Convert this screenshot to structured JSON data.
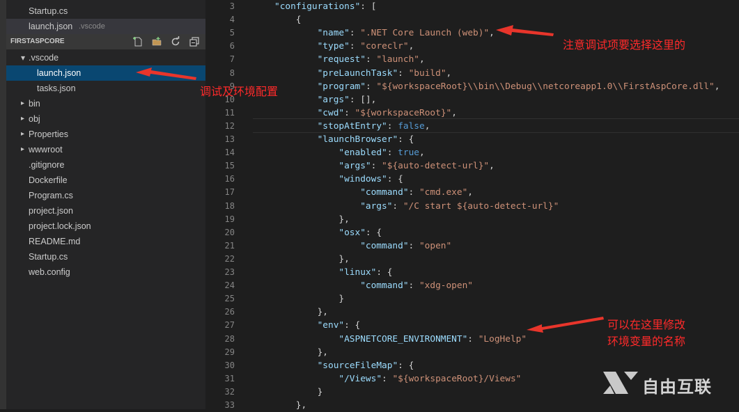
{
  "explorer": {
    "open_editors": [
      {
        "label": "Startup.cs",
        "suffix": ""
      },
      {
        "label": "launch.json",
        "suffix": ".vscode"
      }
    ],
    "section_title": "FIRSTASPCORE",
    "tree": [
      {
        "label": ".vscode",
        "level": 1,
        "chevron": "down"
      },
      {
        "label": "launch.json",
        "level": 2,
        "chevron": "",
        "selected": true
      },
      {
        "label": "tasks.json",
        "level": 2,
        "chevron": ""
      },
      {
        "label": "bin",
        "level": 1,
        "chevron": "right"
      },
      {
        "label": "obj",
        "level": 1,
        "chevron": "right"
      },
      {
        "label": "Properties",
        "level": 1,
        "chevron": "right"
      },
      {
        "label": "wwwroot",
        "level": 1,
        "chevron": "right"
      },
      {
        "label": ".gitignore",
        "level": 1,
        "chevron": ""
      },
      {
        "label": "Dockerfile",
        "level": 1,
        "chevron": ""
      },
      {
        "label": "Program.cs",
        "level": 1,
        "chevron": ""
      },
      {
        "label": "project.json",
        "level": 1,
        "chevron": ""
      },
      {
        "label": "project.lock.json",
        "level": 1,
        "chevron": ""
      },
      {
        "label": "README.md",
        "level": 1,
        "chevron": ""
      },
      {
        "label": "Startup.cs",
        "level": 1,
        "chevron": ""
      },
      {
        "label": "web.config",
        "level": 1,
        "chevron": ""
      }
    ]
  },
  "editor": {
    "current_line": 12,
    "lines": [
      {
        "n": "3",
        "indent": 0,
        "parts": [
          [
            "k",
            "\"configurations\""
          ],
          [
            "p",
            ": ["
          ]
        ]
      },
      {
        "n": "4",
        "indent": 1,
        "parts": [
          [
            "p",
            "{"
          ]
        ]
      },
      {
        "n": "5",
        "indent": 2,
        "parts": [
          [
            "k",
            "\"name\""
          ],
          [
            "p",
            ": "
          ],
          [
            "s",
            "\".NET Core Launch (web)\""
          ],
          [
            "p",
            ","
          ]
        ]
      },
      {
        "n": "6",
        "indent": 2,
        "parts": [
          [
            "k",
            "\"type\""
          ],
          [
            "p",
            ": "
          ],
          [
            "s",
            "\"coreclr\""
          ],
          [
            "p",
            ","
          ]
        ]
      },
      {
        "n": "7",
        "indent": 2,
        "parts": [
          [
            "k",
            "\"request\""
          ],
          [
            "p",
            ": "
          ],
          [
            "s",
            "\"launch\""
          ],
          [
            "p",
            ","
          ]
        ]
      },
      {
        "n": "8",
        "indent": 2,
        "parts": [
          [
            "k",
            "\"preLaunchTask\""
          ],
          [
            "p",
            ": "
          ],
          [
            "s",
            "\"build\""
          ],
          [
            "p",
            ","
          ]
        ]
      },
      {
        "n": "9",
        "indent": 2,
        "parts": [
          [
            "k",
            "\"program\""
          ],
          [
            "p",
            ": "
          ],
          [
            "s",
            "\"${workspaceRoot}\\\\bin\\\\Debug\\\\netcoreapp1.0\\\\FirstAspCore.dll\""
          ],
          [
            "p",
            ","
          ]
        ]
      },
      {
        "n": "10",
        "indent": 2,
        "parts": [
          [
            "k",
            "\"args\""
          ],
          [
            "p",
            ": [],"
          ]
        ]
      },
      {
        "n": "11",
        "indent": 2,
        "parts": [
          [
            "k",
            "\"cwd\""
          ],
          [
            "p",
            ": "
          ],
          [
            "s",
            "\"${workspaceRoot}\""
          ],
          [
            "p",
            ","
          ]
        ]
      },
      {
        "n": "12",
        "indent": 2,
        "parts": [
          [
            "k",
            "\"stopAtEntry\""
          ],
          [
            "p",
            ": "
          ],
          [
            "b",
            "false"
          ],
          [
            "p",
            ","
          ]
        ]
      },
      {
        "n": "13",
        "indent": 2,
        "parts": [
          [
            "k",
            "\"launchBrowser\""
          ],
          [
            "p",
            ": {"
          ]
        ]
      },
      {
        "n": "14",
        "indent": 3,
        "parts": [
          [
            "k",
            "\"enabled\""
          ],
          [
            "p",
            ": "
          ],
          [
            "b",
            "true"
          ],
          [
            "p",
            ","
          ]
        ]
      },
      {
        "n": "15",
        "indent": 3,
        "parts": [
          [
            "k",
            "\"args\""
          ],
          [
            "p",
            ": "
          ],
          [
            "s",
            "\"${auto-detect-url}\""
          ],
          [
            "p",
            ","
          ]
        ]
      },
      {
        "n": "16",
        "indent": 3,
        "parts": [
          [
            "k",
            "\"windows\""
          ],
          [
            "p",
            ": {"
          ]
        ]
      },
      {
        "n": "17",
        "indent": 4,
        "parts": [
          [
            "k",
            "\"command\""
          ],
          [
            "p",
            ": "
          ],
          [
            "s",
            "\"cmd.exe\""
          ],
          [
            "p",
            ","
          ]
        ]
      },
      {
        "n": "18",
        "indent": 4,
        "parts": [
          [
            "k",
            "\"args\""
          ],
          [
            "p",
            ": "
          ],
          [
            "s",
            "\"/C start ${auto-detect-url}\""
          ]
        ]
      },
      {
        "n": "19",
        "indent": 3,
        "parts": [
          [
            "p",
            "},"
          ]
        ]
      },
      {
        "n": "20",
        "indent": 3,
        "parts": [
          [
            "k",
            "\"osx\""
          ],
          [
            "p",
            ": {"
          ]
        ]
      },
      {
        "n": "21",
        "indent": 4,
        "parts": [
          [
            "k",
            "\"command\""
          ],
          [
            "p",
            ": "
          ],
          [
            "s",
            "\"open\""
          ]
        ]
      },
      {
        "n": "22",
        "indent": 3,
        "parts": [
          [
            "p",
            "},"
          ]
        ]
      },
      {
        "n": "23",
        "indent": 3,
        "parts": [
          [
            "k",
            "\"linux\""
          ],
          [
            "p",
            ": {"
          ]
        ]
      },
      {
        "n": "24",
        "indent": 4,
        "parts": [
          [
            "k",
            "\"command\""
          ],
          [
            "p",
            ": "
          ],
          [
            "s",
            "\"xdg-open\""
          ]
        ]
      },
      {
        "n": "25",
        "indent": 3,
        "parts": [
          [
            "p",
            "}"
          ]
        ]
      },
      {
        "n": "26",
        "indent": 2,
        "parts": [
          [
            "p",
            "},"
          ]
        ]
      },
      {
        "n": "27",
        "indent": 2,
        "parts": [
          [
            "k",
            "\"env\""
          ],
          [
            "p",
            ": {"
          ]
        ]
      },
      {
        "n": "28",
        "indent": 3,
        "parts": [
          [
            "k",
            "\"ASPNETCORE_ENVIRONMENT\""
          ],
          [
            "p",
            ": "
          ],
          [
            "s",
            "\"LogHelp\""
          ]
        ]
      },
      {
        "n": "29",
        "indent": 2,
        "parts": [
          [
            "p",
            "},"
          ]
        ]
      },
      {
        "n": "30",
        "indent": 2,
        "parts": [
          [
            "k",
            "\"sourceFileMap\""
          ],
          [
            "p",
            ": {"
          ]
        ]
      },
      {
        "n": "31",
        "indent": 3,
        "parts": [
          [
            "k",
            "\"/Views\""
          ],
          [
            "p",
            ": "
          ],
          [
            "s",
            "\"${workspaceRoot}/Views\""
          ]
        ]
      },
      {
        "n": "32",
        "indent": 2,
        "parts": [
          [
            "p",
            "}"
          ]
        ]
      },
      {
        "n": "33",
        "indent": 1,
        "parts": [
          [
            "p",
            "},"
          ]
        ]
      }
    ]
  },
  "annotations": {
    "note_name": "注意调试项要选择这里的",
    "note_launch": "调试及环境配置",
    "note_env_line1": "可以在这里修改",
    "note_env_line2": "环境变量的名称"
  },
  "watermark": {
    "text": "自由互联"
  },
  "colors": {
    "key": "#9cdcfe",
    "string": "#ce9178",
    "boolean": "#569cd6",
    "selection": "#094771",
    "annotation": "#ff2a2a"
  }
}
